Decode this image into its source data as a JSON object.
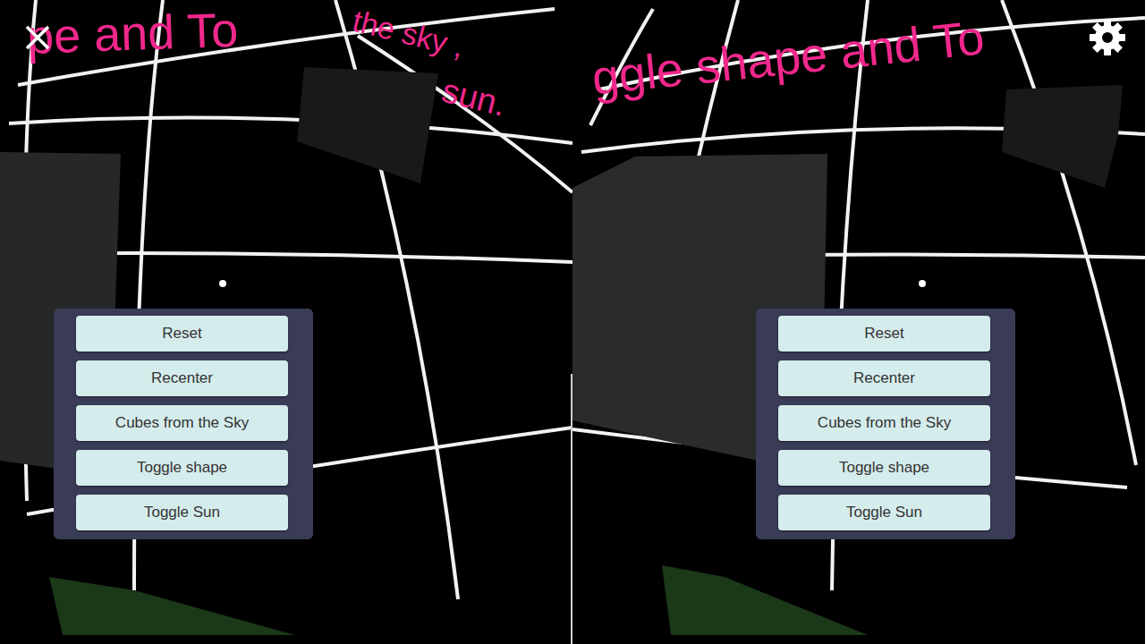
{
  "eyes": [
    {
      "banner": [
        "pe and To",
        "the sky ,",
        "sun."
      ],
      "menu": {
        "buttons": [
          "Reset",
          "Recenter",
          "Cubes from the Sky",
          "Toggle shape",
          "Toggle Sun"
        ]
      }
    },
    {
      "banner": [
        "ggle shape and To"
      ],
      "menu": {
        "buttons": [
          "Reset",
          "Recenter",
          "Cubes from the Sky",
          "Toggle shape",
          "Toggle Sun"
        ]
      }
    }
  ]
}
